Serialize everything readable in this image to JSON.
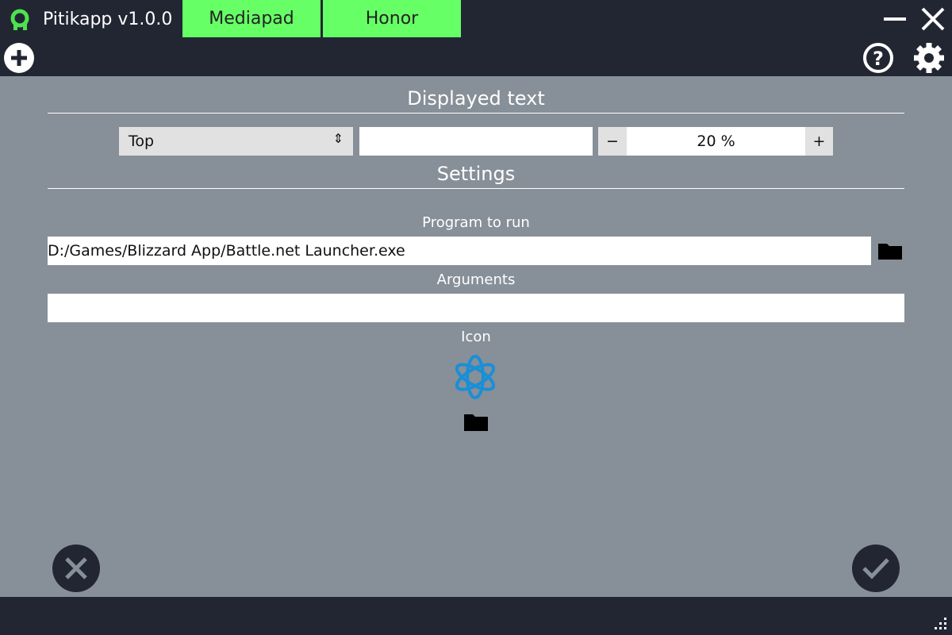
{
  "app": {
    "title": "Pitikapp v1.0.0",
    "tabs": [
      "Mediapad",
      "Honor"
    ]
  },
  "displayed_text": {
    "heading": "Displayed text",
    "position": "Top",
    "text": "",
    "size": "20 %",
    "minus": "−",
    "plus": "+"
  },
  "settings": {
    "heading": "Settings",
    "program_label": "Program to run",
    "program_value": "D:/Games/Blizzard App/Battle.net Launcher.exe",
    "arguments_label": "Arguments",
    "arguments_value": "",
    "icon_label": "Icon"
  },
  "colors": {
    "accent": "#66ff66",
    "bar": "#222633",
    "background": "#878f98"
  }
}
